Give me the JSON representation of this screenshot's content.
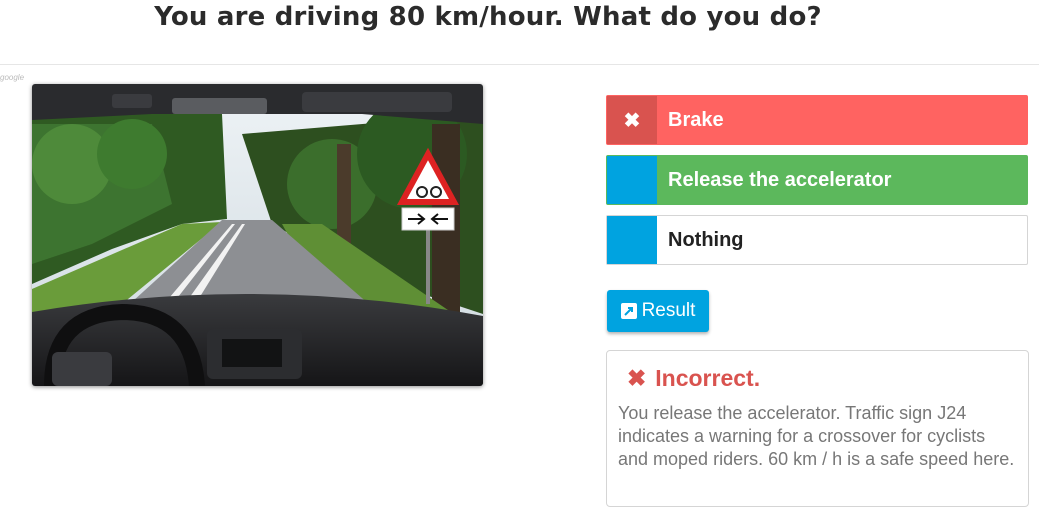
{
  "question": {
    "title": "You are driving 80 km/hour. What do you do?"
  },
  "watermark": "google",
  "scene": {
    "description_icon": "dashboard-road-photo"
  },
  "answers": [
    {
      "label": "Brake",
      "state": "wrong",
      "marker": "✖"
    },
    {
      "label": "Release the accelerator",
      "state": "correct",
      "marker": ""
    },
    {
      "label": "Nothing",
      "state": "neutral",
      "marker": ""
    }
  ],
  "result_button": {
    "label": "Result",
    "icon": "external-link-icon"
  },
  "feedback": {
    "icon": "✖",
    "title": "Incorrect.",
    "text": "You release the accelerator. Traffic sign J24 indicates a warning for a crossover for cyclists and moped riders. 60 km / h is a safe speed here."
  },
  "colors": {
    "wrong": "#ff6361",
    "wrong_marker": "#d9534f",
    "correct": "#5cb85c",
    "accent": "#00a3e0"
  }
}
